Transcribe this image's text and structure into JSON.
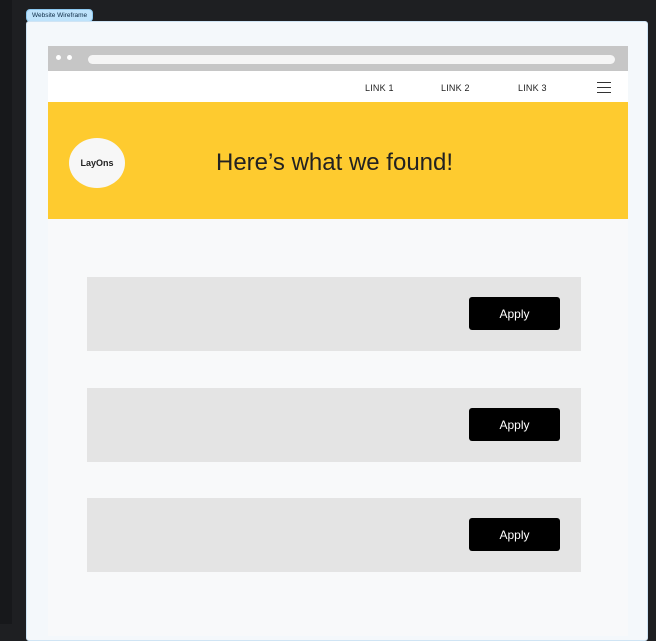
{
  "frame": {
    "label": "Website Wireframe"
  },
  "nav": {
    "links": [
      "LINK 1",
      "LINK 2",
      "LINK 3"
    ],
    "menu_icon": "hamburger-menu-icon"
  },
  "hero": {
    "logo_text": "LayOns",
    "title": "Here’s what we found!",
    "background": "#fecb2f"
  },
  "results": {
    "items": [
      {
        "button_label": "Apply"
      },
      {
        "button_label": "Apply"
      },
      {
        "button_label": "Apply"
      }
    ]
  }
}
